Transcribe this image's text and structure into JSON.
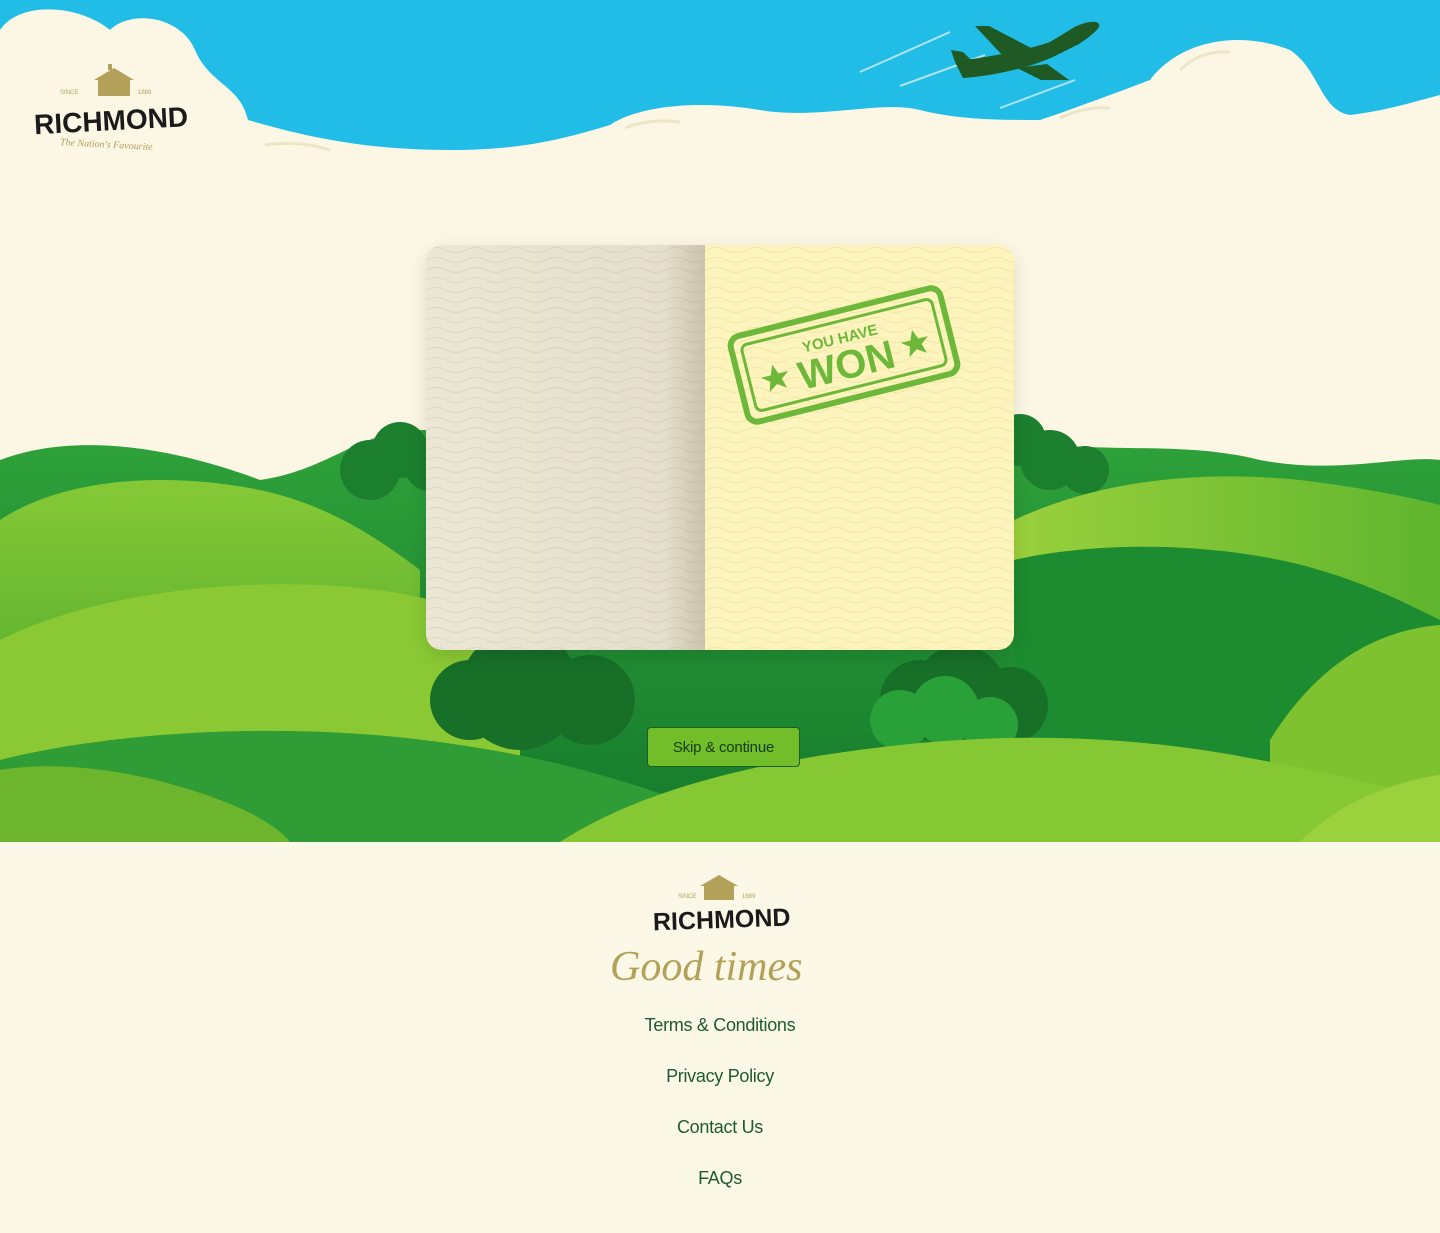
{
  "brand": {
    "name": "RICHMOND",
    "since": "SINCE",
    "year": "1889",
    "tagline": "The Nation's Favourite",
    "footer_slogan": "Good times"
  },
  "stamp": {
    "line1": "YOU HAVE",
    "line2": "WON"
  },
  "actions": {
    "skip_label": "Skip & continue"
  },
  "footer": {
    "links": [
      "Terms & Conditions",
      "Privacy Policy",
      "Contact Us",
      "FAQs"
    ]
  },
  "colors": {
    "sky": "#22bde6",
    "cloud": "#fbf7e4",
    "hill_light": "#7cc030",
    "hill_dark": "#1f8a2e",
    "stamp_green": "#6db83a",
    "link_green": "#1e5b2c",
    "plane": "#1f5a24",
    "gold": "#b3a15a"
  },
  "icons": [
    "airplane-icon",
    "farmhouse-icon",
    "star-icon"
  ]
}
